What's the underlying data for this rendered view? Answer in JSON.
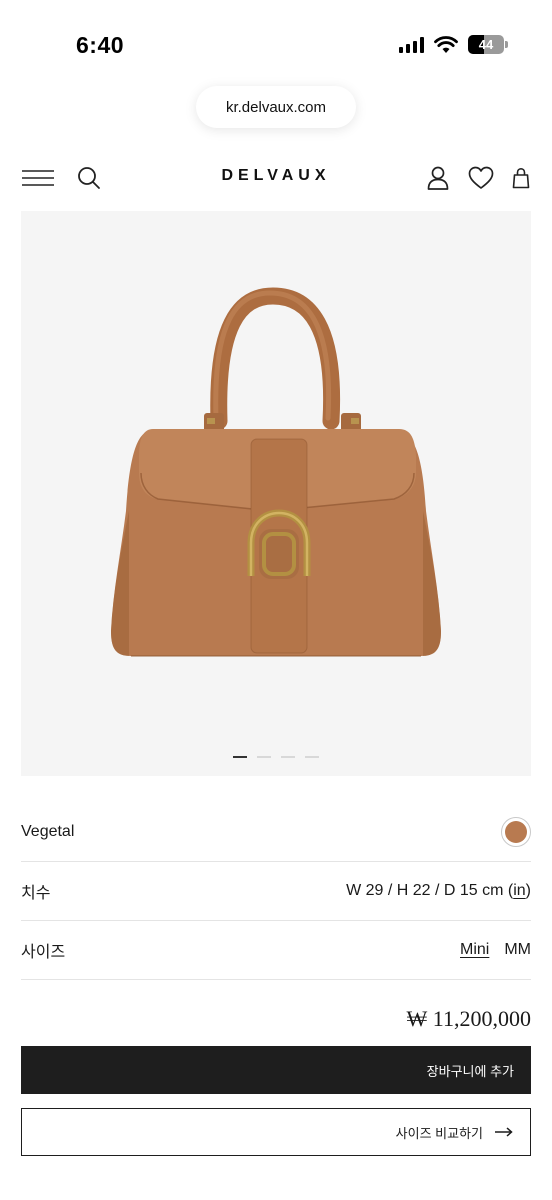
{
  "status_bar": {
    "time": "6:40",
    "battery": "44"
  },
  "browser": {
    "url": "kr.delvaux.com"
  },
  "header": {
    "brand": "DELVAUX",
    "icons": [
      "menu-icon",
      "search-icon",
      "account-icon",
      "heart-icon",
      "bag-icon"
    ]
  },
  "product": {
    "image_alt": "tan leather handbag",
    "carousel": {
      "total": 4,
      "active": 1
    },
    "color_name": "Vegetal",
    "color_swatch": "#b87a50",
    "dimensions_label": "치수",
    "dimensions_value": "W 29 / H 22 / D 15 cm (",
    "dimensions_unit_link": "in",
    "dimensions_close": ")",
    "size_label": "사이즈",
    "sizes": [
      "Mini",
      "MM"
    ],
    "selected_size": "Mini",
    "price": "₩ 11,200,000"
  },
  "actions": {
    "add_to_cart": "장바구니에 추가",
    "compare_sizes": "사이즈 비교하기"
  },
  "colors": {
    "accent_dark": "#1e1e1e",
    "bag_leather": "#b87a50"
  }
}
